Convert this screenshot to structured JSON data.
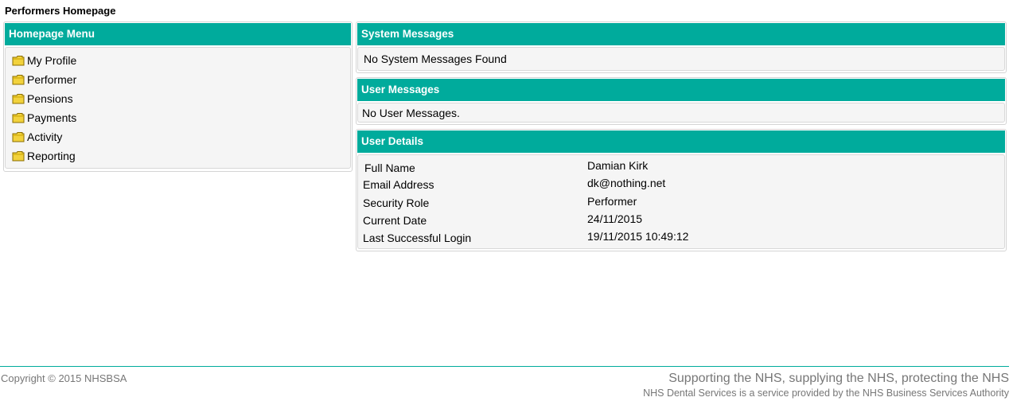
{
  "page": {
    "title": "Performers Homepage"
  },
  "menu": {
    "header": "Homepage Menu",
    "items": [
      {
        "label": "My Profile",
        "icon": "folder-icon"
      },
      {
        "label": "Performer",
        "icon": "folder-icon"
      },
      {
        "label": "Pensions",
        "icon": "folder-icon"
      },
      {
        "label": "Payments",
        "icon": "folder-icon"
      },
      {
        "label": "Activity",
        "icon": "folder-icon"
      },
      {
        "label": "Reporting",
        "icon": "folder-icon"
      }
    ]
  },
  "system_messages": {
    "header": "System Messages",
    "text": "No System Messages Found"
  },
  "user_messages": {
    "header": "User Messages",
    "text": "No User Messages."
  },
  "user_details": {
    "header": "User Details",
    "rows": [
      {
        "label": "Full Name",
        "value": "Damian Kirk"
      },
      {
        "label": "Email Address",
        "value": "dk@nothing.net"
      },
      {
        "label": "Security Role",
        "value": "Performer"
      },
      {
        "label": "Current Date",
        "value": "24/11/2015"
      },
      {
        "label": "Last Successful Login",
        "value": "19/11/2015 10:49:12"
      }
    ]
  },
  "footer": {
    "copyright": "Copyright © 2015 NHSBSA",
    "tagline": "Supporting the NHS, supplying the NHS, protecting the NHS",
    "service_note": "NHS Dental Services is a service provided by the NHS Business Services Authority"
  },
  "colors": {
    "header_bg": "#00ab9c",
    "panel_body_bg": "#f5f5f5",
    "footer_text": "#777777",
    "folder_yellow": "#f2d23c"
  }
}
